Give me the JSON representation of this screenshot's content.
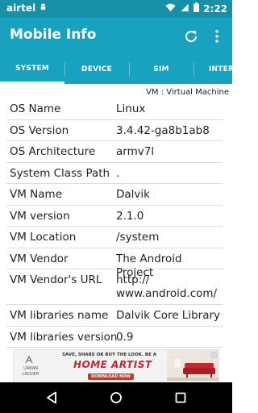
{
  "status_bar": {
    "carrier": "airtel",
    "time": "2:22"
  },
  "app": {
    "title": "Mobile Info"
  },
  "tabs": [
    {
      "label": "SYSTEM",
      "active": true
    },
    {
      "label": "DEVICE",
      "active": false
    },
    {
      "label": "SIM",
      "active": false
    },
    {
      "label": "INTER",
      "active": false
    }
  ],
  "vm_note": "VM : Virtual Machine",
  "rows": [
    {
      "label": "OS Name",
      "value": "Linux"
    },
    {
      "label": "OS Version",
      "value": "3.4.42-ga8b1ab8"
    },
    {
      "label": "OS Architecture",
      "value": "armv7l"
    },
    {
      "label": "System Class Path",
      "value": "."
    },
    {
      "label": "VM Name",
      "value": "Dalvik"
    },
    {
      "label": "VM version",
      "value": "2.1.0"
    },
    {
      "label": "VM Location",
      "value": "/system"
    },
    {
      "label": "VM Vendor",
      "value": "The Android Project"
    },
    {
      "label": "VM Vendor's URL",
      "value_line1": "http://",
      "value_line2": "www.android.com/"
    },
    {
      "label": "VM libraries name",
      "value": "Dalvik Core Library"
    },
    {
      "label": "VM libraries version",
      "value": "0.9"
    }
  ],
  "ad": {
    "brand": "URBAN LADDER",
    "headline": "SAVE, SHARE OR BUY THE LOOK. BE A",
    "title": "HOME ARTIST",
    "cta": "DOWNLOAD NOW"
  },
  "colors": {
    "primary": "#19a2c0",
    "primary_dark": "#1790a8",
    "text": "#222222"
  }
}
